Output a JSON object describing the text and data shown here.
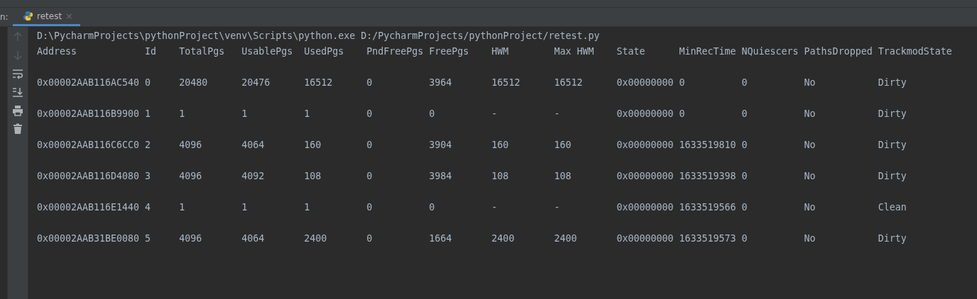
{
  "panel": {
    "label": "n:"
  },
  "tabs": [
    {
      "label": "retest",
      "selected": true,
      "close": "×"
    }
  ],
  "toolbar": [
    {
      "kind": "up",
      "disabled": true
    },
    {
      "kind": "down",
      "disabled": true
    },
    {
      "kind": "wrap",
      "disabled": false
    },
    {
      "kind": "scroll-end",
      "disabled": false
    },
    {
      "kind": "print",
      "disabled": false
    },
    {
      "kind": "trash",
      "disabled": false
    }
  ],
  "console": {
    "command": "D:\\PycharmProjects\\pythonProject\\venv\\Scripts\\python.exe D:/PycharmProjects/pythonProject/retest.py",
    "columns": [
      "Address",
      "Id",
      "TotalPgs",
      "UsablePgs",
      "UsedPgs",
      "PndFreePgs",
      "FreePgs",
      "HWM",
      "Max HWM",
      "State",
      "MinRecTime",
      "NQuiescers",
      "PathsDropped",
      "TrackmodState"
    ],
    "rows": [
      [
        "0x00002AAB116AC540",
        "0",
        "20480",
        "20476",
        "16512",
        "0",
        "3964",
        "16512",
        "16512",
        "0x00000000",
        "0",
        "0",
        "No",
        "Dirty"
      ],
      [
        "0x00002AAB116B9900",
        "1",
        "1",
        "1",
        "1",
        "0",
        "0",
        "-",
        "-",
        "0x00000000",
        "0",
        "0",
        "No",
        "Dirty"
      ],
      [
        "0x00002AAB116C6CC0",
        "2",
        "4096",
        "4064",
        "160",
        "0",
        "3904",
        "160",
        "160",
        "0x00000000",
        "1633519810",
        "0",
        "No",
        "Dirty"
      ],
      [
        "0x00002AAB116D4080",
        "3",
        "4096",
        "4092",
        "108",
        "0",
        "3984",
        "108",
        "108",
        "0x00000000",
        "1633519398",
        "0",
        "No",
        "Dirty"
      ],
      [
        "0x00002AAB116E1440",
        "4",
        "1",
        "1",
        "1",
        "0",
        "0",
        "-",
        "-",
        "0x00000000",
        "1633519566",
        "0",
        "No",
        "Clean"
      ],
      [
        "0x00002AAB31BE0080",
        "5",
        "4096",
        "4064",
        "2400",
        "0",
        "1664",
        "2400",
        "2400",
        "0x00000000",
        "1633519573",
        "0",
        "No",
        "Dirty"
      ]
    ]
  }
}
